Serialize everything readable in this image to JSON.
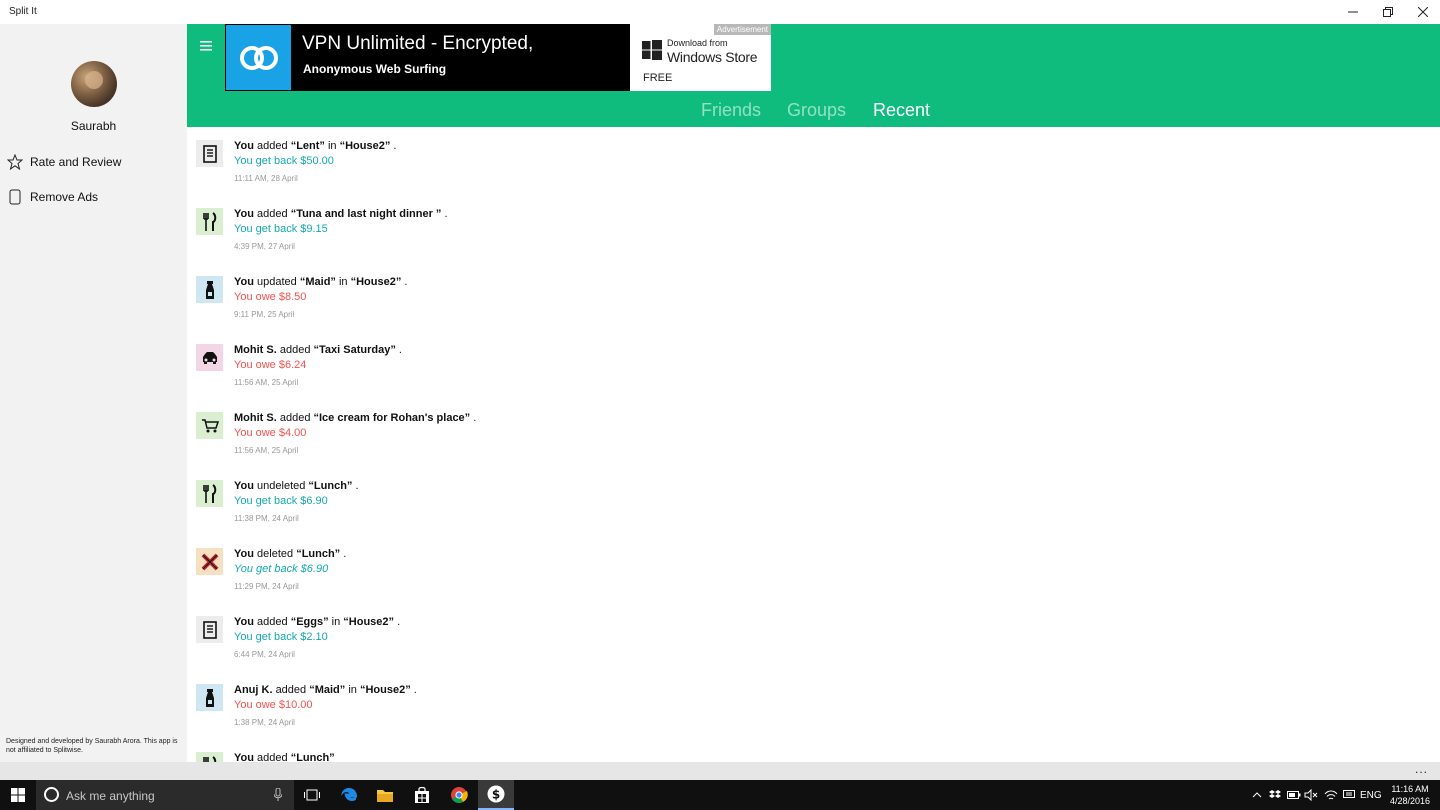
{
  "window": {
    "title": "Split It",
    "minimize_icon": "minimize-icon",
    "maximize_icon": "restore-icon",
    "close_icon": "close-icon"
  },
  "sidebar": {
    "username": "Saurabh",
    "items": [
      {
        "label": "Rate and Review",
        "icon": "star-icon"
      },
      {
        "label": "Remove Ads",
        "icon": "phone-icon"
      }
    ],
    "disclaimer": "Designed and developed by Saurabh Arora. This app is not affiliated to Splitwise."
  },
  "ad": {
    "title": "VPN Unlimited - Encrypted,",
    "subtitle": "Anonymous Web Surfing",
    "tag": "Advertisement",
    "store_line1": "Download from",
    "store_line2": "Windows Store",
    "price": "FREE"
  },
  "tabs": [
    {
      "label": "Friends",
      "active": false
    },
    {
      "label": "Groups",
      "active": false
    },
    {
      "label": "Recent",
      "active": true
    }
  ],
  "activity": [
    {
      "actor": "You",
      "verb": "added",
      "item": "“Lent”",
      "connector": "in",
      "group": "“House2”",
      "end": ".",
      "amount": "You get back $50.00",
      "type": "pos",
      "time": "11:11 AM, 28 April",
      "icon": "receipt-icon"
    },
    {
      "actor": "You",
      "verb": "added",
      "item": "“Tuna and last night dinner ”",
      "connector": "",
      "group": "",
      "end": ".",
      "amount": "You get back $9.15",
      "type": "pos",
      "time": "4:39 PM, 27 April",
      "icon": "utensils-icon"
    },
    {
      "actor": "You",
      "verb": "updated",
      "item": "“Maid”",
      "connector": "in",
      "group": "“House2”",
      "end": ".",
      "amount": "You owe $8.50",
      "type": "neg",
      "time": "9:11 PM, 25 April",
      "icon": "spray-bottle-icon"
    },
    {
      "actor": "Mohit S.",
      "verb": "added",
      "item": "“Taxi Saturday”",
      "connector": "",
      "group": "",
      "end": ".",
      "amount": "You owe $6.24",
      "type": "neg",
      "time": "11:56 AM, 25 April",
      "icon": "car-icon"
    },
    {
      "actor": "Mohit S.",
      "verb": "added",
      "item": "“Ice cream for Rohan's place”",
      "connector": "",
      "group": "",
      "end": ".",
      "amount": "You owe $4.00",
      "type": "neg",
      "time": "11:56 AM, 25 April",
      "icon": "cart-icon"
    },
    {
      "actor": "You",
      "verb": "undeleted",
      "item": "“Lunch”",
      "connector": "",
      "group": "",
      "end": ".",
      "amount": "You get back $6.90",
      "type": "pos",
      "time": "11:38 PM, 24 April",
      "icon": "utensils-icon"
    },
    {
      "actor": "You",
      "verb": "deleted",
      "item": "“Lunch”",
      "connector": "",
      "group": "",
      "end": ".",
      "amount": "You get back $6.90",
      "type": "pos-italic",
      "time": "11:29 PM, 24 April",
      "icon": "deleted-x-icon"
    },
    {
      "actor": "You",
      "verb": "added",
      "item": "“Eggs”",
      "connector": "in",
      "group": "“House2”",
      "end": ".",
      "amount": "You get back $2.10",
      "type": "pos",
      "time": "6:44 PM, 24 April",
      "icon": "receipt-icon"
    },
    {
      "actor": "Anuj K.",
      "verb": "added",
      "item": "“Maid”",
      "connector": "in",
      "group": "“House2”",
      "end": ".",
      "amount": "You owe $10.00",
      "type": "neg",
      "time": "1:38 PM, 24 April",
      "icon": "spray-bottle-icon"
    },
    {
      "actor": "You",
      "verb": "added",
      "item": "“Lunch”",
      "connector": "",
      "group": "",
      "end": "",
      "amount": "",
      "type": "pos",
      "time": "",
      "icon": "utensils-icon"
    }
  ],
  "appbar": {
    "more": "..."
  },
  "taskbar": {
    "search_placeholder": "Ask me anything",
    "tray_lang": "ENG",
    "clock_time": "11:16 AM",
    "clock_date": "4/28/2016"
  },
  "colors": {
    "accent": "#0fbc7d",
    "positive": "#14a8ad",
    "negative": "#f0534f"
  }
}
